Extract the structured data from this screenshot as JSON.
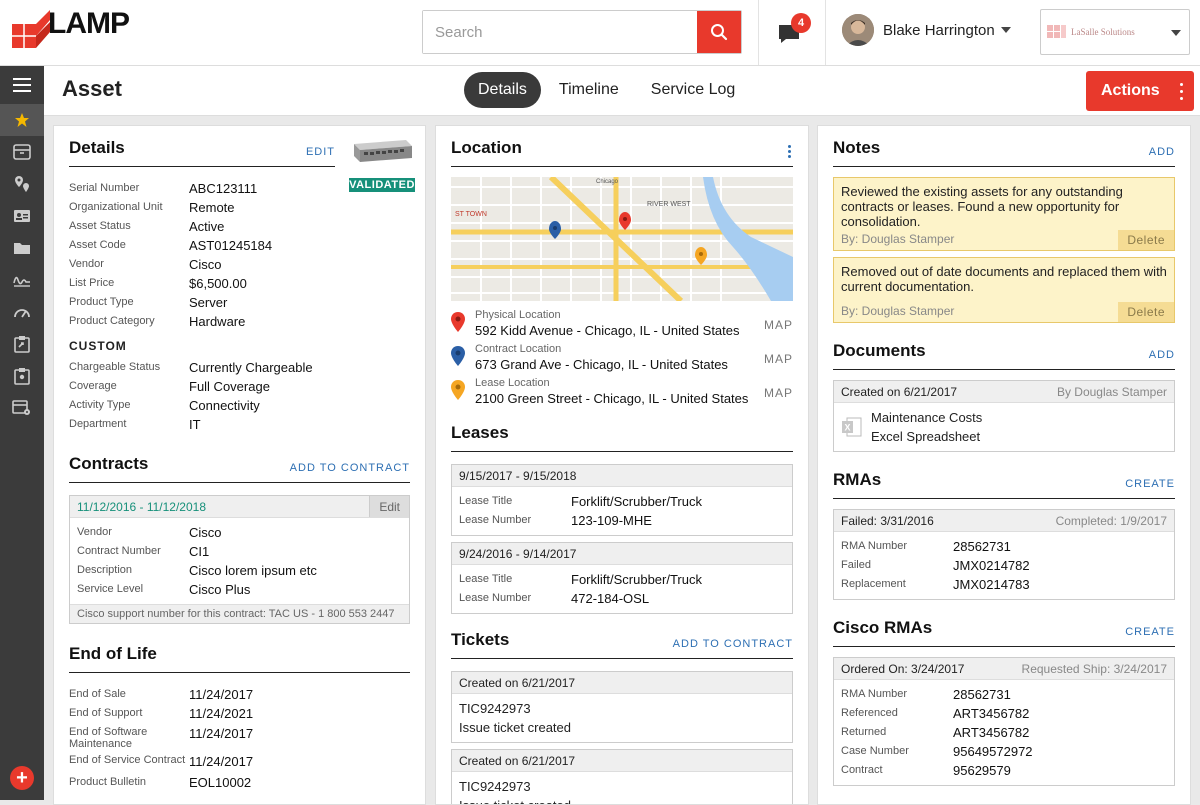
{
  "brand": {
    "name": "LAMP"
  },
  "search": {
    "placeholder": "Search"
  },
  "notifications": {
    "count": "4"
  },
  "user": {
    "name": "Blake Harrington"
  },
  "company": {
    "name": "LaSalle Solutions"
  },
  "page": {
    "title": "Asset"
  },
  "tabs": [
    {
      "label": "Details",
      "active": true
    },
    {
      "label": "Timeline",
      "active": false
    },
    {
      "label": "Service Log",
      "active": false
    }
  ],
  "actions": {
    "label": "Actions"
  },
  "details": {
    "title": "Details",
    "edit": "EDIT",
    "badge": "VALIDATED",
    "fields": [
      {
        "k": "Serial Number",
        "v": "ABC123111"
      },
      {
        "k": "Organizational Unit",
        "v": "Remote"
      },
      {
        "k": "Asset Status",
        "v": "Active"
      },
      {
        "k": "Asset Code",
        "v": "AST01245184"
      },
      {
        "k": "Vendor",
        "v": "Cisco"
      },
      {
        "k": "List Price",
        "v": "$6,500.00"
      },
      {
        "k": "Product Type",
        "v": "Server"
      },
      {
        "k": "Product Category",
        "v": "Hardware"
      }
    ],
    "custom_title": "CUSTOM",
    "custom": [
      {
        "k": "Chargeable Status",
        "v": "Currently Chargeable"
      },
      {
        "k": "Coverage",
        "v": "Full Coverage"
      },
      {
        "k": "Activity Type",
        "v": "Connectivity"
      },
      {
        "k": "Department",
        "v": "IT"
      }
    ]
  },
  "contracts": {
    "title": "Contracts",
    "add": "ADD TO CONTRACT",
    "card": {
      "dates": "11/12/2016 - 11/12/2018",
      "edit": "Edit",
      "fields": [
        {
          "k": "Vendor",
          "v": "Cisco"
        },
        {
          "k": "Contract Number",
          "v": "CI1"
        },
        {
          "k": "Description",
          "v": "Cisco lorem ipsum etc"
        },
        {
          "k": "Service Level",
          "v": "Cisco Plus"
        }
      ],
      "footer": "Cisco support number for this contract: TAC US - 1 800 553 2447"
    }
  },
  "eol": {
    "title": "End of Life",
    "fields": [
      {
        "k": "End of Sale",
        "v": "11/24/2017"
      },
      {
        "k": "End of Support",
        "v": "11/24/2021"
      },
      {
        "k": "End of Software Maintenance",
        "v": "11/24/2017"
      },
      {
        "k": "End of Service Contract",
        "v": "11/24/2017"
      },
      {
        "k": "Product Bulletin",
        "v": "EOL10002"
      }
    ]
  },
  "location": {
    "title": "Location",
    "map_labels": {
      "chicago": "Chicago",
      "river_west": "RIVER WEST",
      "town": "ST TOWN"
    },
    "items": [
      {
        "label": "Physical Location",
        "address": "592 Kidd Avenue - Chicago, IL - United States",
        "map": "MAP"
      },
      {
        "label": "Contract Location",
        "address": "673 Grand Ave - Chicago, IL - United States",
        "map": "MAP"
      },
      {
        "label": "Lease Location",
        "address": "2100 Green Street - Chicago, IL - United States",
        "map": "MAP"
      }
    ]
  },
  "leases": {
    "title": "Leases",
    "items": [
      {
        "dates": "9/15/2017 - 9/15/2018",
        "title_k": "Lease Title",
        "title_v": "Forklift/Scrubber/Truck",
        "num_k": "Lease Number",
        "num_v": "123-109-MHE"
      },
      {
        "dates": "9/24/2016 - 9/14/2017",
        "title_k": "Lease Title",
        "title_v": "Forklift/Scrubber/Truck",
        "num_k": "Lease Number",
        "num_v": "472-184-OSL"
      }
    ]
  },
  "tickets": {
    "title": "Tickets",
    "add": "ADD TO CONTRACT",
    "items": [
      {
        "created": "Created on 6/21/2017",
        "id": "TIC9242973",
        "desc": "Issue ticket created"
      },
      {
        "created": "Created on 6/21/2017",
        "id": "TIC9242973",
        "desc": "Issue ticket created"
      }
    ]
  },
  "notes": {
    "title": "Notes",
    "add": "ADD",
    "items": [
      {
        "text": "Reviewed the existing assets for any outstanding contracts or leases. Found a new opportunity for consolidation.",
        "by": "By: Douglas Stamper",
        "delete": "Delete"
      },
      {
        "text": "Removed out of date documents and replaced them with current documentation.",
        "by": "By: Douglas Stamper",
        "delete": "Delete"
      }
    ]
  },
  "documents": {
    "title": "Documents",
    "add": "ADD",
    "item": {
      "created": "Created on 6/21/2017",
      "by": "By Douglas Stamper",
      "name": "Maintenance Costs",
      "type": "Excel Spreadsheet"
    }
  },
  "rmas": {
    "title": "RMAs",
    "create": "CREATE",
    "item": {
      "failed": "Failed: 3/31/2016",
      "completed": "Completed: 1/9/2017",
      "fields": [
        {
          "k": "RMA Number",
          "v": "28562731"
        },
        {
          "k": "Failed",
          "v": "JMX0214782"
        },
        {
          "k": "Replacement",
          "v": "JMX0214783"
        }
      ]
    }
  },
  "cisco_rmas": {
    "title": "Cisco RMAs",
    "create": "CREATE",
    "item": {
      "ordered": "Ordered On: 3/24/2017",
      "requested": "Requested Ship: 3/24/2017",
      "fields": [
        {
          "k": "RMA Number",
          "v": "28562731"
        },
        {
          "k": "Referenced",
          "v": "ART3456782"
        },
        {
          "k": "Returned",
          "v": "ART3456782"
        },
        {
          "k": "Case Number",
          "v": "95649572972"
        },
        {
          "k": "Contract",
          "v": "95629579"
        }
      ]
    }
  },
  "colors": {
    "accent": "#e8392c",
    "link": "#2d6fb3",
    "green": "#16907a",
    "sidebar": "#3b3b3b"
  }
}
